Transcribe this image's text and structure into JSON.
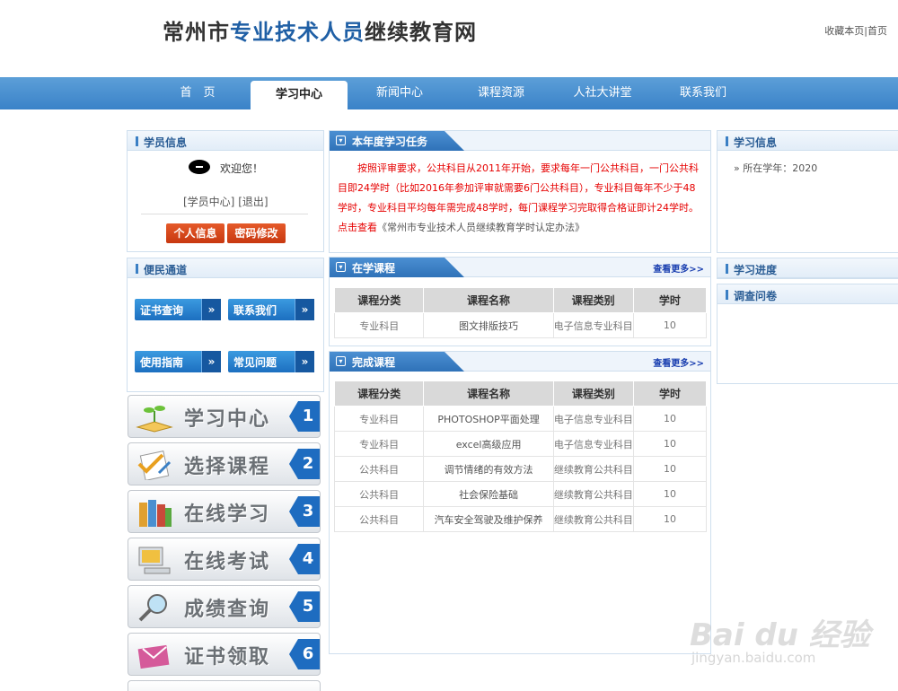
{
  "header": {
    "title_part1": "常州市",
    "title_part2": "专业技术人员",
    "title_part3": "继续教育网",
    "top_links": {
      "favorite": "收藏本页",
      "separator": "|",
      "home": "首页"
    }
  },
  "nav": {
    "items": [
      {
        "label": "首　页",
        "active": false
      },
      {
        "label": "学习中心",
        "active": true
      },
      {
        "label": "新闻中心",
        "active": false
      },
      {
        "label": "课程资源",
        "active": false
      },
      {
        "label": "人社大讲堂",
        "active": false
      },
      {
        "label": "联系我们",
        "active": false
      }
    ]
  },
  "student_info": {
    "title": "学员信息",
    "welcome": "欢迎您！",
    "link_center": "[学员中心]",
    "link_logout": "[退出]",
    "btn_profile": "个人信息",
    "btn_password": "密码修改"
  },
  "convenience": {
    "title": "便民通道",
    "buttons": [
      "证书查询",
      "联系我们",
      "使用指南",
      "常见问题"
    ],
    "arrow": "»"
  },
  "big_nav": [
    {
      "label": "学习中心",
      "num": "1",
      "icon": "seedling-book-icon"
    },
    {
      "label": "选择课程",
      "num": "2",
      "icon": "checklist-icon"
    },
    {
      "label": "在线学习",
      "num": "3",
      "icon": "books-icon"
    },
    {
      "label": "在线考试",
      "num": "4",
      "icon": "computer-icon"
    },
    {
      "label": "成绩查询",
      "num": "5",
      "icon": "magnifier-icon"
    },
    {
      "label": "证书领取",
      "num": "6",
      "icon": "certificate-icon"
    }
  ],
  "annual_task": {
    "title": "本年度学习任务",
    "text_red": "按照评审要求，公共科目从2011年开始，要求每年一门公共科目，一门公共科目即24学时（比如2016年参加评审就需要6门公共科目），专业科目每年不少于48学时，专业科目平均每年需完成48学时，每门课程学习完取得合格证即计24学时。点击查看",
    "text_link": "《常州市专业技术人员继续教育学时认定办法》"
  },
  "current_courses": {
    "title": "在学课程",
    "more": "查看更多>>",
    "headers": [
      "课程分类",
      "课程名称",
      "课程类别",
      "学时"
    ],
    "rows": [
      [
        "专业科目",
        "图文排版技巧",
        "电子信息专业科目",
        "10"
      ]
    ]
  },
  "completed_courses": {
    "title": "完成课程",
    "more": "查看更多>>",
    "headers": [
      "课程分类",
      "课程名称",
      "课程类别",
      "学时"
    ],
    "rows": [
      [
        "专业科目",
        "PHOTOSHOP平面处理",
        "电子信息专业科目",
        "10"
      ],
      [
        "专业科目",
        "excel高级应用",
        "电子信息专业科目",
        "10"
      ],
      [
        "公共科目",
        "调节情绪的有效方法",
        "继续教育公共科目",
        "10"
      ],
      [
        "公共科目",
        "社会保险基础",
        "继续教育公共科目",
        "10"
      ],
      [
        "公共科目",
        "汽车安全驾驶及维护保养",
        "继续教育公共科目",
        "10"
      ]
    ]
  },
  "learning_info": {
    "title": "学习信息",
    "year_label": "» 所在学年：2020"
  },
  "progress": {
    "title": "学习进度"
  },
  "survey": {
    "title": "调查问卷"
  },
  "watermark": {
    "logo": "Bai du 经验",
    "url": "jingyan.baidu.com"
  }
}
